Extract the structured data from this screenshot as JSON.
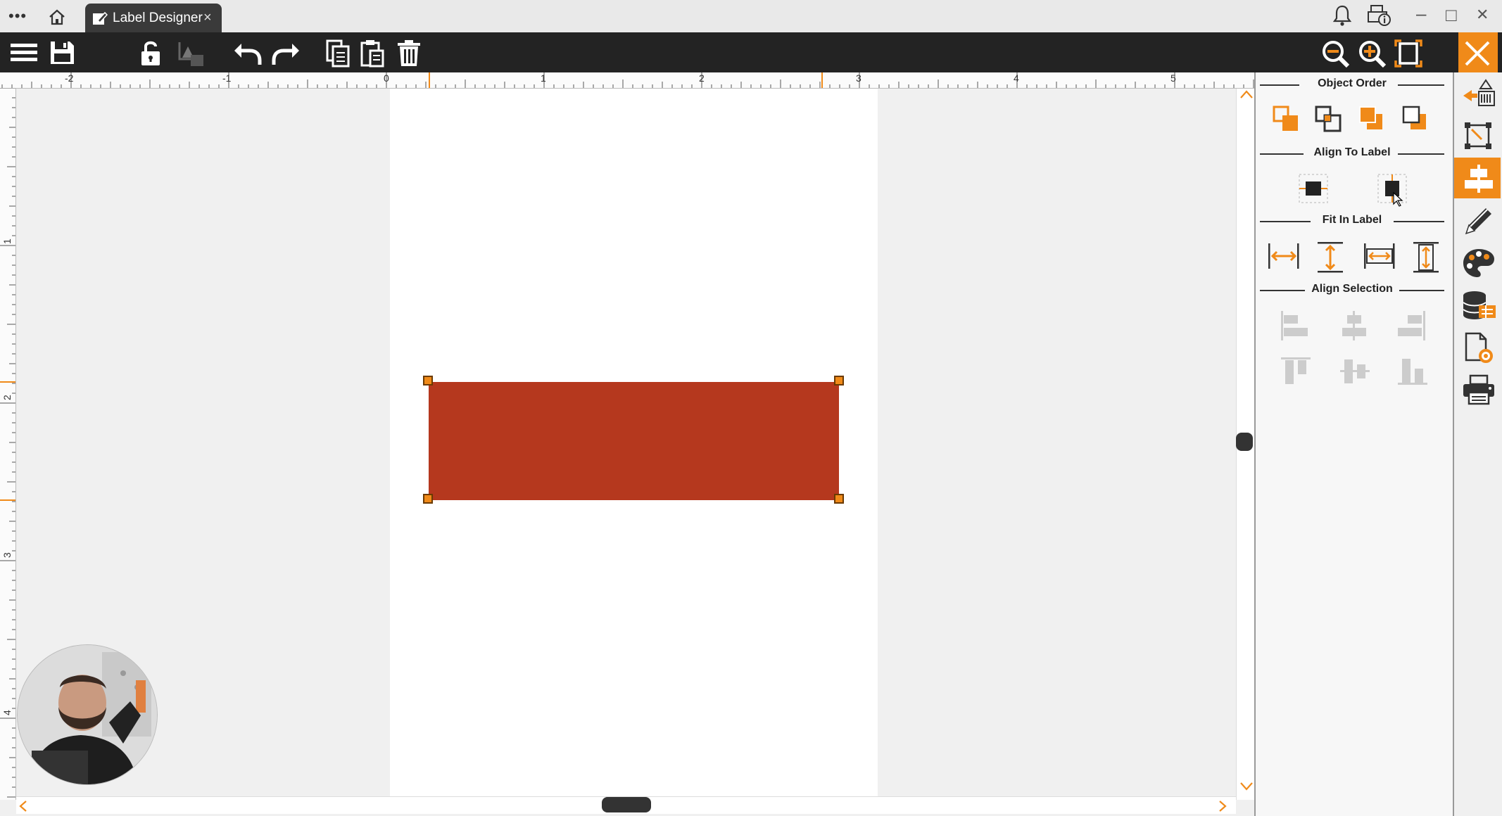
{
  "titlebar": {
    "menu_icon": "more-horizontal-icon",
    "home_icon": "home-icon",
    "tab_label": "Label Designer",
    "tab_close": "×",
    "notifications_icon": "bell-icon",
    "printer_info_icon": "printer-info-icon"
  },
  "window_controls": {
    "minimize": "–",
    "maximize": "□",
    "close": "✕"
  },
  "toolbar": {
    "left": [
      "hamburger-menu-icon",
      "save-icon",
      "lock-open-icon",
      "group-objects-icon",
      "undo-icon",
      "redo-icon",
      "copy-icon",
      "paste-icon",
      "delete-icon"
    ],
    "right": [
      "zoom-out-icon",
      "zoom-in-icon",
      "fit-to-window-icon",
      "close-designer-icon"
    ]
  },
  "ruler": {
    "horizontal_labels": [
      "-2",
      "-1",
      "0",
      "1",
      "2",
      "3",
      "4",
      "5"
    ],
    "vertical_labels": [
      "1",
      "2",
      "3",
      "4"
    ]
  },
  "canvas": {
    "label_background": "#ffffff",
    "shape_color": "#b5381e",
    "handle_color": "#f08a19"
  },
  "panel": {
    "object_order": {
      "title": "Object Order",
      "buttons": [
        "bring-forward-icon",
        "send-backward-icon",
        "bring-to-front-icon",
        "send-to-back-icon"
      ]
    },
    "align_to_label": {
      "title": "Align To Label",
      "buttons": [
        "center-horizontally-icon",
        "center-vertically-icon"
      ]
    },
    "fit_in_label": {
      "title": "Fit In Label",
      "buttons": [
        "fit-width-icon",
        "fit-height-icon",
        "stretch-width-icon",
        "stretch-height-icon"
      ]
    },
    "align_selection": {
      "title": "Align Selection",
      "buttons": [
        "align-left-icon",
        "align-center-icon",
        "align-right-icon",
        "align-top-icon",
        "align-middle-icon",
        "align-bottom-icon"
      ]
    }
  },
  "side_strip": [
    "add-objects-icon",
    "transform-icon",
    "alignment-icon",
    "edit-pencil-icon",
    "color-palette-icon",
    "database-icon",
    "label-settings-icon",
    "print-icon"
  ],
  "active_side_tab": "alignment-icon",
  "colors": {
    "accent": "#f08a19",
    "toolbar_bg": "#232323",
    "tab_bg": "#3a3a3a"
  }
}
